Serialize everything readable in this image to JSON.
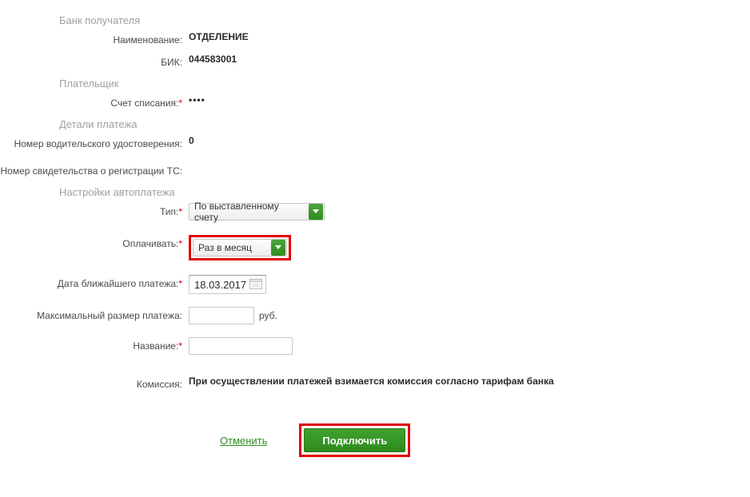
{
  "sections": {
    "bank_receiver": "Банк получателя",
    "payer": "Плательщик",
    "payment_details": "Детали платежа",
    "autopay_settings": "Настройки автоплатежа"
  },
  "labels": {
    "name": "Наименование:",
    "bik": "БИК:",
    "debit_account": "Счет списания:",
    "driver_license": "Номер водительского удостоверения:",
    "vehicle_reg": "Номер свидетельства о регистрации ТС:",
    "type": "Тип:",
    "pay": "Оплачивать:",
    "next_date": "Дата ближайшего платежа:",
    "max_amount": "Максимальный размер платежа:",
    "title": "Название:",
    "commission": "Комиссия:"
  },
  "values": {
    "name": "ОТДЕЛЕНИЕ",
    "bik": "044583001",
    "debit_account": "••••",
    "driver_license": "0",
    "vehicle_reg": "",
    "type_selected": "По выставленному счету",
    "pay_selected": "Раз в месяц",
    "next_date": "18.03.2017",
    "max_amount": "",
    "currency_unit": "руб.",
    "title": "",
    "commission": "При осуществлении платежей взимается комиссия согласно тарифам банка"
  },
  "actions": {
    "cancel": "Отменить",
    "connect": "Подключить"
  }
}
